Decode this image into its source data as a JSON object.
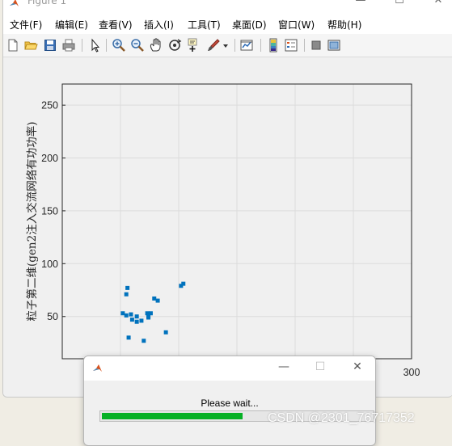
{
  "window": {
    "title": "Figure 1"
  },
  "menu": [
    "文件(F)",
    "编辑(E)",
    "查看(V)",
    "插入(I)",
    "工具(T)",
    "桌面(D)",
    "窗口(W)",
    "帮助(H)"
  ],
  "toolbar": [
    "new-file-icon",
    "open-folder-icon",
    "save-icon",
    "print-icon",
    "pointer-icon",
    "zoom-in-icon",
    "zoom-out-icon",
    "pan-icon",
    "rotate-3d-icon",
    "data-cursor-icon",
    "brush-icon",
    "link-plot-icon",
    "colorbar-icon",
    "legend-icon",
    "hide-plot-tools-icon",
    "show-plot-tools-icon"
  ],
  "chart_data": {
    "type": "scatter",
    "title": "",
    "xlabel": "",
    "ylabel": "粒子第二维(gen2注入交流网络有功功率)",
    "ylim": [
      10,
      270
    ],
    "yticks": [
      50,
      100,
      150,
      200,
      250
    ],
    "ytick_labels": [
      "50",
      "100",
      "150",
      "200",
      "250"
    ],
    "xlim": [
      0,
      300
    ],
    "xticks": [
      0,
      50,
      100,
      150,
      200,
      250,
      300
    ],
    "xtick_labels_visible": [
      "300"
    ],
    "grid": true,
    "marker_color": "#0072bd",
    "series": [
      {
        "points": [
          [
            56,
            77
          ],
          [
            55,
            71
          ],
          [
            55,
            51
          ],
          [
            52,
            53
          ],
          [
            59,
            52
          ],
          [
            60,
            47
          ],
          [
            64,
            50
          ],
          [
            64,
            45
          ],
          [
            68,
            46
          ],
          [
            57,
            30
          ],
          [
            73,
            53
          ],
          [
            74,
            49
          ],
          [
            74,
            50
          ],
          [
            76,
            53
          ],
          [
            79,
            67
          ],
          [
            82,
            65
          ],
          [
            70,
            27
          ],
          [
            89,
            35
          ],
          [
            102,
            79
          ],
          [
            104,
            81
          ]
        ]
      }
    ]
  },
  "dialog": {
    "message": "Please wait...",
    "progress": 0.52,
    "progress_color": "#06b025"
  },
  "watermark": "CSDN @2301_76717352"
}
